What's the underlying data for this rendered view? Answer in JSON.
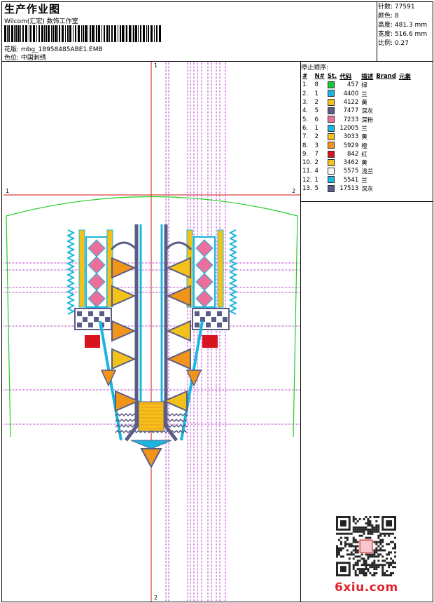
{
  "header": {
    "title": "生产作业图",
    "subtitle": "Wilcom(汇宏) 数饰工作室",
    "design_label": "花版:",
    "design_value": "mbg_18958485ABE1.EMB",
    "color_label": "色位:",
    "color_value": "中国刺绣"
  },
  "stats": {
    "stitches_label": "针数:",
    "stitches": "77591",
    "colors_label": "颜色:",
    "colors": "8",
    "height_label": "高度:",
    "height": "481.3 mm",
    "width_label": "宽度:",
    "width": "516.6 mm",
    "scale_label": "比例:",
    "scale": "0.27"
  },
  "legend": {
    "heading": "停止顺序:",
    "columns": [
      "#",
      "N#",
      "St.",
      "代码",
      "描述",
      "Brand",
      "元素"
    ],
    "rows": [
      {
        "idx": "1.",
        "n": "8",
        "color": "#18c63a",
        "st": "457",
        "desc": "绿"
      },
      {
        "idx": "2.",
        "n": "1",
        "color": "#19b6e0",
        "st": "4400",
        "desc": "兰"
      },
      {
        "idx": "3.",
        "n": "2",
        "color": "#f2c21a",
        "st": "4122",
        "desc": "黄"
      },
      {
        "idx": "4.",
        "n": "5",
        "color": "#5b5c86",
        "st": "7477",
        "desc": "深灰"
      },
      {
        "idx": "5.",
        "n": "6",
        "color": "#ec6f9b",
        "st": "7233",
        "desc": "深粉"
      },
      {
        "idx": "6.",
        "n": "1",
        "color": "#19b6e0",
        "st": "12005",
        "desc": "兰"
      },
      {
        "idx": "7.",
        "n": "2",
        "color": "#f2c21a",
        "st": "3033",
        "desc": "黄"
      },
      {
        "idx": "8.",
        "n": "3",
        "color": "#f0941a",
        "st": "5929",
        "desc": "橙"
      },
      {
        "idx": "9.",
        "n": "7",
        "color": "#d8141e",
        "st": "842",
        "desc": "红"
      },
      {
        "idx": "10.",
        "n": "2",
        "color": "#f2c21a",
        "st": "3462",
        "desc": "黄"
      },
      {
        "idx": "11.",
        "n": "4",
        "color": "#f4f4f4",
        "st": "5575",
        "desc": "浅兰"
      },
      {
        "idx": "12.",
        "n": "1",
        "color": "#19b6e0",
        "st": "5541",
        "desc": "兰"
      },
      {
        "idx": "13.",
        "n": "5",
        "color": "#5b5c86",
        "st": "17513",
        "desc": "深灰"
      }
    ]
  },
  "axis_labels": {
    "top": "1",
    "bottom": "2",
    "left": "1",
    "right": "2"
  },
  "watermark": "6xiu.com",
  "palette": {
    "guide_red": "#d01010",
    "guide_purple": "#b020c8",
    "outline_green": "#22cc22",
    "blue": "#19b6e0",
    "yellow": "#f2c21a",
    "orange": "#f0941a",
    "gray": "#5b5c86",
    "pink": "#ec6f9b",
    "red": "#d8141e",
    "green": "#18c63a"
  }
}
